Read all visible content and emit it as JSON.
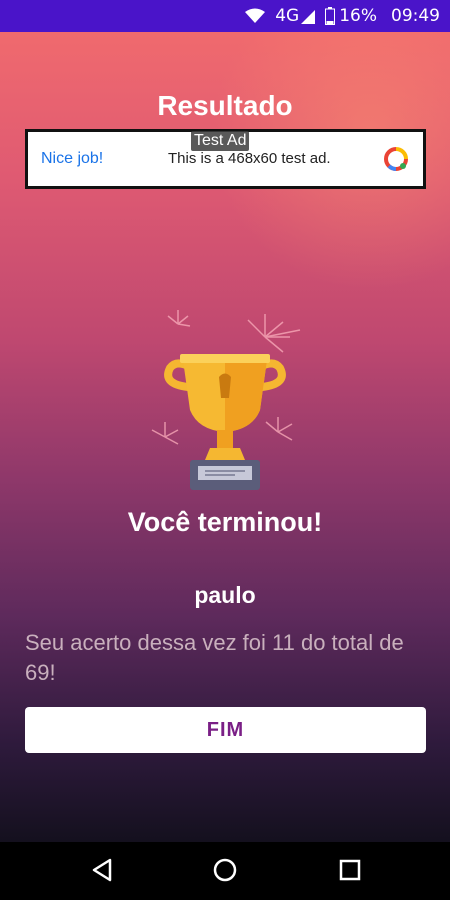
{
  "status_bar": {
    "network": "4G",
    "battery": "16%",
    "time": "09:49"
  },
  "screen": {
    "title": "Resultado"
  },
  "ad": {
    "label": "Test Ad",
    "headline": "Nice job!",
    "text": "This is a 468x60 test ad."
  },
  "result": {
    "heading": "Você terminou!",
    "player": "paulo",
    "message": "Seu acerto dessa vez foi 11 do total de 69!"
  },
  "actions": {
    "finish_label": "FIM"
  },
  "colors": {
    "status_bar": "#4a14c9",
    "button_text": "#7a1f86",
    "ad_headline": "#1a73e8"
  },
  "icons": [
    "wifi-icon",
    "signal-icon",
    "battery-icon",
    "ad-choices-icon",
    "trophy-icon",
    "back-icon",
    "home-icon",
    "recents-icon"
  ]
}
